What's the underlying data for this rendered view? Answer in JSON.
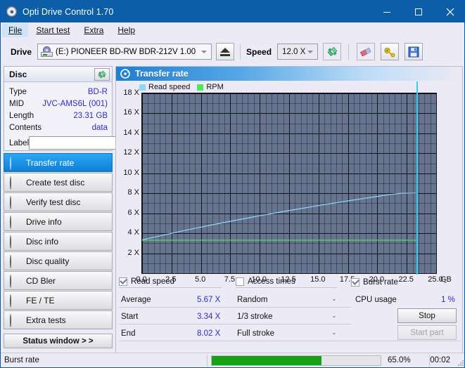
{
  "window": {
    "title": "Opti Drive Control 1.70",
    "icon": "disc-icon",
    "minimize": "minimize-icon",
    "maximize": "maximize-icon",
    "close": "close-icon",
    "titlebar_color": "#0c5ea8"
  },
  "menu": {
    "items": [
      {
        "label": "File",
        "active": true
      },
      {
        "label": "Start test",
        "active": false
      },
      {
        "label": "Extra",
        "active": false
      },
      {
        "label": "Help",
        "active": false
      }
    ]
  },
  "toolbar": {
    "drive_label": "Drive",
    "drive_value": "(E:)  PIONEER BD-RW   BDR-212V 1.00",
    "eject_title": "eject",
    "speed_label": "Speed",
    "speed_value": "12.0 X",
    "icons": [
      "refresh-icon",
      "eraser-icon",
      "key-icon",
      "save-icon"
    ]
  },
  "disc_panel": {
    "title": "Disc",
    "refresh_icon": "refresh-icon",
    "rows": [
      {
        "key": "Type",
        "value": "BD-R"
      },
      {
        "key": "MID",
        "value": "JVC-AMS6L (001)"
      },
      {
        "key": "Length",
        "value": "23.31 GB"
      },
      {
        "key": "Contents",
        "value": "data"
      }
    ],
    "label_key": "Label",
    "label_value": "",
    "label_placeholder": "",
    "label_button_icon": "disc-icon"
  },
  "sidebar": {
    "items": [
      {
        "label": "Transfer rate",
        "selected": true
      },
      {
        "label": "Create test disc",
        "selected": false
      },
      {
        "label": "Verify test disc",
        "selected": false
      },
      {
        "label": "Drive info",
        "selected": false
      },
      {
        "label": "Disc info",
        "selected": false
      },
      {
        "label": "Disc quality",
        "selected": false
      },
      {
        "label": "CD Bler",
        "selected": false
      },
      {
        "label": "FE / TE",
        "selected": false
      },
      {
        "label": "Extra tests",
        "selected": false
      }
    ],
    "status_window": "Status window > >"
  },
  "panel": {
    "title": "Transfer rate",
    "icon": "disc-icon"
  },
  "checkboxes": [
    {
      "label": "Read speed",
      "checked": true
    },
    {
      "label": "Access times",
      "checked": false
    },
    {
      "label": "Burst rate",
      "checked": true,
      "value": "-"
    }
  ],
  "results": {
    "rows": [
      {
        "key": "Average",
        "value": "5.67 X",
        "key2": "Random",
        "value2": "-"
      },
      {
        "key": "Start",
        "value": "3.34 X",
        "key2": "1/3 stroke",
        "value2": "-"
      },
      {
        "key": "End",
        "value": "8.02 X",
        "key2": "Full stroke",
        "value2": "-"
      }
    ],
    "cpu_label": "CPU usage",
    "cpu_value": "1 %",
    "stop_button": "Stop",
    "start_part_button": "Start part"
  },
  "statusbar": {
    "text": "Burst rate",
    "progress_percent": 65.0,
    "progress_label": "65.0%",
    "elapsed": "00:02",
    "progress_color": "#15a015"
  },
  "chart_data": {
    "type": "line",
    "title": "Transfer rate",
    "xlabel": "GB",
    "ylabel": "X",
    "xlim": [
      0.0,
      25.0
    ],
    "ylim": [
      0.0,
      18.0
    ],
    "xticks": [
      "0.0",
      "2.5",
      "5.0",
      "7.5",
      "10.0",
      "12.5",
      "15.0",
      "17.5",
      "20.0",
      "22.5",
      "25.0"
    ],
    "xtick_values": [
      0.0,
      2.5,
      5.0,
      7.5,
      10.0,
      12.5,
      15.0,
      17.5,
      20.0,
      22.5,
      25.0
    ],
    "yticks": [
      "2 X",
      "4 X",
      "6 X",
      "8 X",
      "10 X",
      "12 X",
      "14 X",
      "16 X",
      "18 X"
    ],
    "ytick_values": [
      2,
      4,
      6,
      8,
      10,
      12,
      14,
      16,
      18
    ],
    "grid": true,
    "minor_grid": true,
    "legend": [
      "Read speed",
      "RPM"
    ],
    "legend_position": "top-left",
    "plot_bg": "#67748f",
    "cursor_x": 23.31,
    "cursor_color": "#33ccf5",
    "series": [
      {
        "name": "Read speed",
        "color": "#8fd8f5",
        "x": [
          0.0,
          1.0,
          2.0,
          3.0,
          4.0,
          5.0,
          6.0,
          7.0,
          8.0,
          9.0,
          10.0,
          11.0,
          12.0,
          13.0,
          14.0,
          15.0,
          16.0,
          17.0,
          18.0,
          19.0,
          20.0,
          21.0,
          22.0,
          23.0,
          23.31
        ],
        "y": [
          3.34,
          3.6,
          3.86,
          4.12,
          4.37,
          4.61,
          4.85,
          5.08,
          5.31,
          5.53,
          5.75,
          5.96,
          6.17,
          6.37,
          6.57,
          6.77,
          6.96,
          7.15,
          7.33,
          7.51,
          7.69,
          7.86,
          8.0,
          8.01,
          8.02
        ]
      },
      {
        "name": "RPM",
        "color": "#49e75b",
        "x": [
          0.0,
          5.0,
          10.0,
          15.0,
          20.0,
          23.31
        ],
        "y": [
          3.3,
          3.3,
          3.3,
          3.3,
          3.3,
          3.3
        ]
      }
    ]
  }
}
